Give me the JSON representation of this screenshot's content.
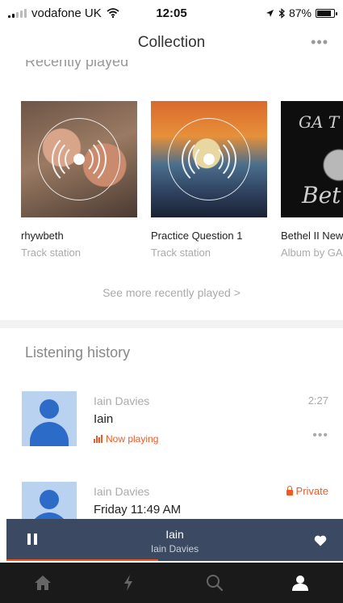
{
  "status_bar": {
    "carrier": "vodafone UK",
    "time": "12:05",
    "battery": "87%",
    "battery_level": 0.87
  },
  "nav": {
    "title": "Collection",
    "more_label": "•••"
  },
  "recently_played": {
    "heading": "Recently played",
    "tiles": [
      {
        "title": "rhywbeth",
        "subtitle": "Track station"
      },
      {
        "title": "Practice Question 1",
        "subtitle": "Track station"
      },
      {
        "title": "Bethel II New",
        "subtitle": "Album by GA",
        "art_top": "GA T",
        "art_bottom": "Bet"
      }
    ],
    "see_more": "See more recently played",
    "see_more_chevron": ">"
  },
  "listening_history": {
    "heading": "Listening history",
    "items": [
      {
        "artist": "Iain Davies",
        "title": "Iain",
        "status": "Now playing",
        "duration": "2:27",
        "more_label": "•••"
      },
      {
        "artist": "Iain Davies",
        "title": "Friday 11:49 AM",
        "privacy": "Private"
      }
    ]
  },
  "mini_player": {
    "title": "Iain",
    "artist": "Iain Davies",
    "progress": 0.45
  },
  "tab_bar": {
    "tabs": [
      "home-icon",
      "stream-bolt-icon",
      "search-icon",
      "collection-user-icon"
    ],
    "active_index": 3
  },
  "colors": {
    "accent": "#f05a22",
    "player_bg": "#3b4a62",
    "tab_bg": "#1a1a1a"
  }
}
